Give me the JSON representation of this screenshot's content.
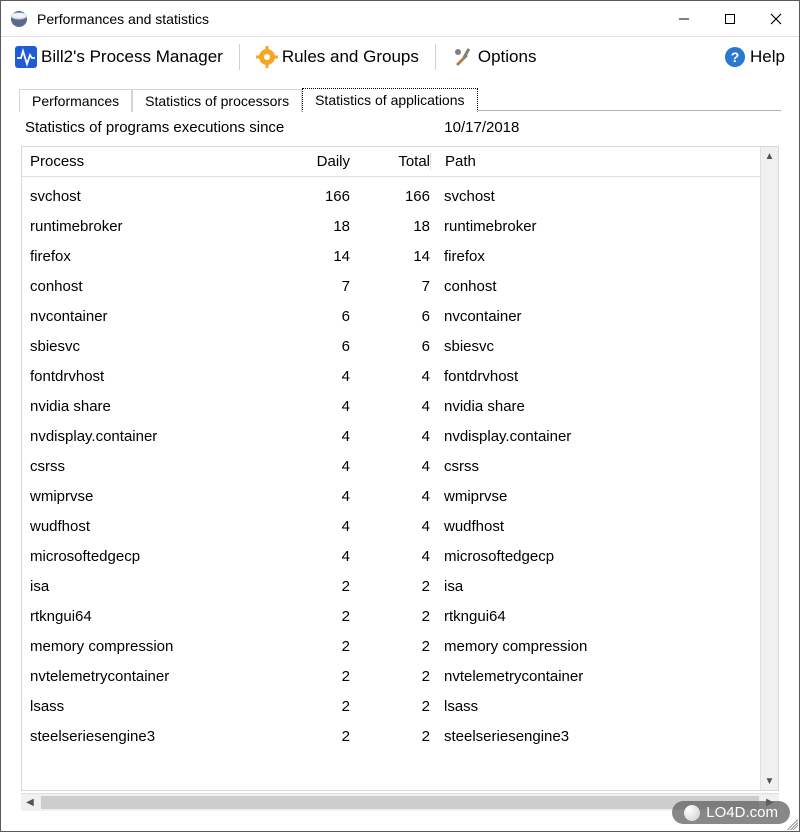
{
  "window": {
    "title": "Performances and statistics"
  },
  "toolbar": {
    "process_manager": "Bill2's Process Manager",
    "rules_groups": "Rules and Groups",
    "options": "Options",
    "help": "Help"
  },
  "tabs": {
    "performances": "Performances",
    "stats_processors": "Statistics of processors",
    "stats_applications": "Statistics of applications"
  },
  "stats": {
    "label": "Statistics of programs executions since",
    "date": "10/17/2018"
  },
  "columns": {
    "process": "Process",
    "daily": "Daily",
    "total": "Total",
    "path": "Path"
  },
  "rows": [
    {
      "process": "svchost",
      "daily": "166",
      "total": "166",
      "path": "svchost"
    },
    {
      "process": "runtimebroker",
      "daily": "18",
      "total": "18",
      "path": "runtimebroker"
    },
    {
      "process": "firefox",
      "daily": "14",
      "total": "14",
      "path": "firefox"
    },
    {
      "process": "conhost",
      "daily": "7",
      "total": "7",
      "path": "conhost"
    },
    {
      "process": "nvcontainer",
      "daily": "6",
      "total": "6",
      "path": "nvcontainer"
    },
    {
      "process": "sbiesvc",
      "daily": "6",
      "total": "6",
      "path": "sbiesvc"
    },
    {
      "process": "fontdrvhost",
      "daily": "4",
      "total": "4",
      "path": "fontdrvhost"
    },
    {
      "process": "nvidia share",
      "daily": "4",
      "total": "4",
      "path": "nvidia share"
    },
    {
      "process": "nvdisplay.container",
      "daily": "4",
      "total": "4",
      "path": "nvdisplay.container"
    },
    {
      "process": "csrss",
      "daily": "4",
      "total": "4",
      "path": "csrss"
    },
    {
      "process": "wmiprvse",
      "daily": "4",
      "total": "4",
      "path": "wmiprvse"
    },
    {
      "process": "wudfhost",
      "daily": "4",
      "total": "4",
      "path": "wudfhost"
    },
    {
      "process": "microsoftedgecp",
      "daily": "4",
      "total": "4",
      "path": "microsoftedgecp"
    },
    {
      "process": "isa",
      "daily": "2",
      "total": "2",
      "path": "isa"
    },
    {
      "process": "rtkngui64",
      "daily": "2",
      "total": "2",
      "path": "rtkngui64"
    },
    {
      "process": "memory compression",
      "daily": "2",
      "total": "2",
      "path": "memory compression"
    },
    {
      "process": "nvtelemetrycontainer",
      "daily": "2",
      "total": "2",
      "path": "nvtelemetrycontainer"
    },
    {
      "process": "lsass",
      "daily": "2",
      "total": "2",
      "path": "lsass"
    },
    {
      "process": "steelseriesengine3",
      "daily": "2",
      "total": "2",
      "path": "steelseriesengine3"
    }
  ],
  "watermark": "LO4D.com"
}
